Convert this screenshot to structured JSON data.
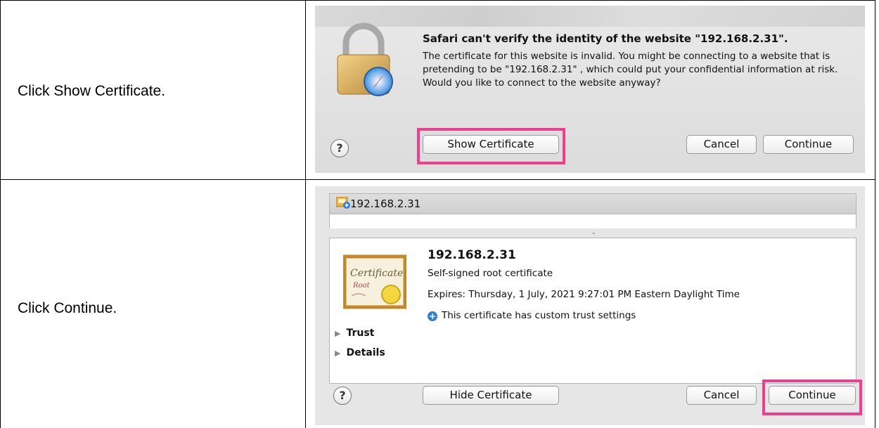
{
  "steps": [
    {
      "instruction": "Click Show Certificate.",
      "dialog": {
        "title": "Safari can't verify the identity of the website \"192.168.2.31\".",
        "body": "The certificate for this website is invalid. You might be connecting to a website that is pretending to be   \"192.168.2.31\"   , which could put your confidential information at risk. Would you like to connect to the website anyway?",
        "help_label": "?",
        "show_certificate_label": "Show Certificate",
        "cancel_label": "Cancel",
        "continue_label": "Continue",
        "highlighted": "Show Certificate"
      }
    },
    {
      "instruction": "Click Continue.",
      "dialog": {
        "header_host": "192.168.2.31",
        "cert_name": "192.168.2.31",
        "cert_type": "Self-signed root certificate",
        "expires": "Expires: Thursday, 1 July, 2021 9:27:01 PM Eastern Daylight Time",
        "trust_note": "This certificate has custom trust settings",
        "trust_label": "Trust",
        "details_label": "Details",
        "help_label": "?",
        "hide_certificate_label": "Hide Certificate",
        "cancel_label": "Cancel",
        "continue_label": "Continue",
        "highlighted": "Continue"
      }
    }
  ],
  "colors": {
    "highlight": "#ee3f8f",
    "info_icon": "#2f7fd6"
  }
}
